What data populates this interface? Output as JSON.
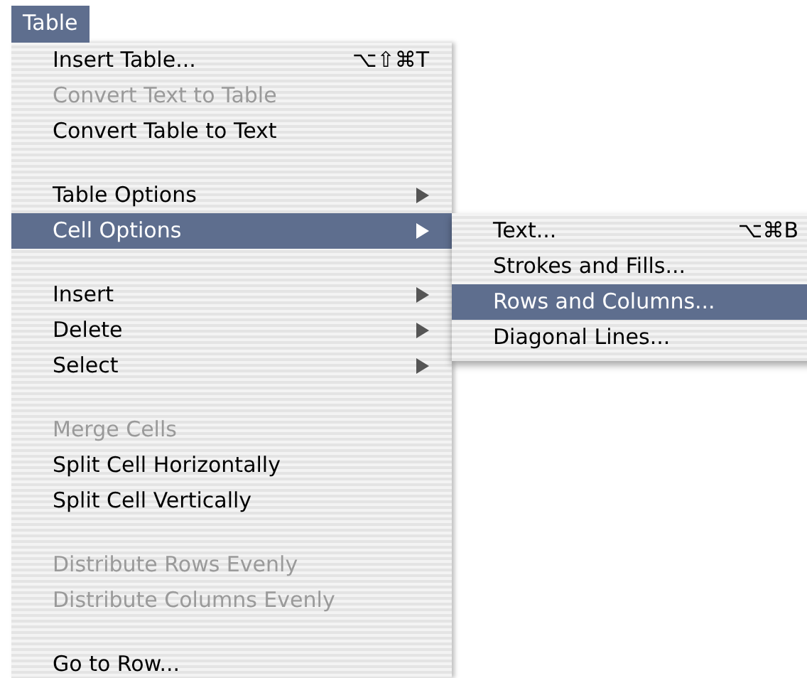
{
  "menu_bar": {
    "title": "Table",
    "selected": true
  },
  "menu": {
    "items": [
      {
        "kind": "item",
        "label": "Insert Table...",
        "shortcut": "⌥⇧⌘T",
        "disabled": false,
        "selected": false,
        "submenu": false
      },
      {
        "kind": "item",
        "label": "Convert Text to Table",
        "disabled": true,
        "selected": false,
        "submenu": false
      },
      {
        "kind": "item",
        "label": "Convert Table to Text",
        "disabled": false,
        "selected": false,
        "submenu": false
      },
      {
        "kind": "separator"
      },
      {
        "kind": "item",
        "label": "Table Options",
        "disabled": false,
        "selected": false,
        "submenu": true
      },
      {
        "kind": "item",
        "label": "Cell Options",
        "disabled": false,
        "selected": true,
        "submenu": true
      },
      {
        "kind": "separator"
      },
      {
        "kind": "item",
        "label": "Insert",
        "disabled": false,
        "selected": false,
        "submenu": true
      },
      {
        "kind": "item",
        "label": "Delete",
        "disabled": false,
        "selected": false,
        "submenu": true
      },
      {
        "kind": "item",
        "label": "Select",
        "disabled": false,
        "selected": false,
        "submenu": true
      },
      {
        "kind": "separator"
      },
      {
        "kind": "item",
        "label": "Merge Cells",
        "disabled": true,
        "selected": false,
        "submenu": false
      },
      {
        "kind": "item",
        "label": "Split Cell Horizontally",
        "disabled": false,
        "selected": false,
        "submenu": false
      },
      {
        "kind": "item",
        "label": "Split Cell Vertically",
        "disabled": false,
        "selected": false,
        "submenu": false
      },
      {
        "kind": "separator"
      },
      {
        "kind": "item",
        "label": "Distribute Rows Evenly",
        "disabled": true,
        "selected": false,
        "submenu": false
      },
      {
        "kind": "item",
        "label": "Distribute Columns Evenly",
        "disabled": true,
        "selected": false,
        "submenu": false
      },
      {
        "kind": "separator"
      },
      {
        "kind": "item",
        "label": "Go to Row...",
        "disabled": false,
        "selected": false,
        "submenu": false
      }
    ]
  },
  "submenu": {
    "items": [
      {
        "kind": "item",
        "label": "Text...",
        "shortcut": "⌥⌘B",
        "disabled": false,
        "selected": false,
        "submenu": false
      },
      {
        "kind": "item",
        "label": "Strokes and Fills...",
        "disabled": false,
        "selected": false,
        "submenu": false
      },
      {
        "kind": "item",
        "label": "Rows and Columns...",
        "disabled": false,
        "selected": true,
        "submenu": false
      },
      {
        "kind": "item",
        "label": "Diagonal Lines...",
        "disabled": false,
        "selected": false,
        "submenu": false
      }
    ]
  }
}
